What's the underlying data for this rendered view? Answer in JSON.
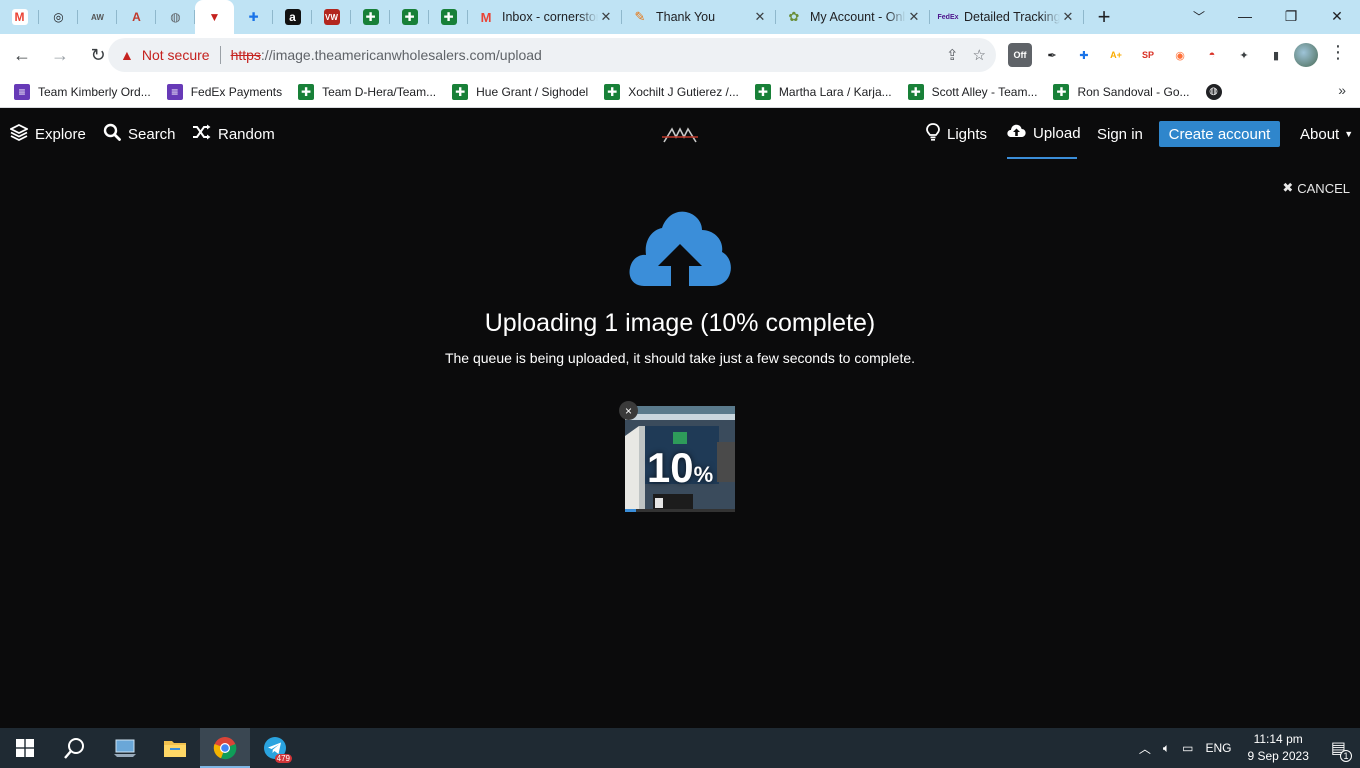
{
  "browser": {
    "pinned_tabs": [
      {
        "name": "gmail",
        "glyph": "M",
        "color": "#ea4335",
        "bg": "#ffffff"
      },
      {
        "name": "chatgpt",
        "glyph": "◎",
        "color": "#202124",
        "bg": "transparent"
      },
      {
        "name": "aw-site",
        "glyph": "AW",
        "color": "#555555",
        "bg": "transparent"
      },
      {
        "name": "aw-site-2",
        "glyph": "A",
        "color": "#c0392b",
        "bg": "transparent"
      },
      {
        "name": "globe",
        "glyph": "◍",
        "color": "#5f6368",
        "bg": "transparent"
      },
      {
        "name": "active-site",
        "glyph": "▼",
        "color": "#c5221f",
        "bg": "transparent"
      },
      {
        "name": "diamond-ext",
        "glyph": "✚",
        "color": "#1a73e8",
        "bg": "transparent"
      },
      {
        "name": "amazon",
        "glyph": "a",
        "color": "#ffffff",
        "bg": "#111111"
      },
      {
        "name": "vw",
        "glyph": "VW",
        "color": "#ffffff",
        "bg": "#b3261e"
      },
      {
        "name": "sheets-1",
        "glyph": "✚",
        "color": "#ffffff",
        "bg": "#188038"
      },
      {
        "name": "sheets-2",
        "glyph": "✚",
        "color": "#ffffff",
        "bg": "#188038"
      },
      {
        "name": "sheets-3",
        "glyph": "✚",
        "color": "#ffffff",
        "bg": "#188038"
      }
    ],
    "wide_tabs": [
      {
        "label": "Inbox - cornerstone",
        "glyph": "M",
        "color": "#ea4335",
        "bg": "transparent"
      },
      {
        "label": "Thank You",
        "glyph": "✎",
        "color": "#e8710a",
        "bg": "transparent"
      },
      {
        "label": "My Account - Online",
        "glyph": "✿",
        "color": "#6a8f3a",
        "bg": "transparent"
      },
      {
        "label": "Detailed Tracking",
        "glyph": "FedEx",
        "color": "#4d148c",
        "bg": "transparent"
      }
    ],
    "url_scheme": "https",
    "url_rest": "://image.theamericanwholesalers.com/upload",
    "security_label": "Not secure",
    "extensions": [
      {
        "name": "off-extension",
        "glyph": "Off",
        "color": "#ffffff",
        "bg": "#5f6368"
      },
      {
        "name": "pen-extension",
        "glyph": "✒",
        "color": "#202124",
        "bg": "transparent"
      },
      {
        "name": "diamond-extension",
        "glyph": "✚",
        "color": "#1a73e8",
        "bg": "transparent"
      },
      {
        "name": "boost-extension",
        "glyph": "A+",
        "color": "#f9ab00",
        "bg": "transparent"
      },
      {
        "name": "alert-extension",
        "glyph": "SP",
        "color": "#d93025",
        "bg": "transparent"
      },
      {
        "name": "firefox-extension",
        "glyph": "◉",
        "color": "#ff7139",
        "bg": "transparent"
      },
      {
        "name": "pokeball-extension",
        "glyph": "◓",
        "color": "#d93025",
        "bg": "transparent"
      },
      {
        "name": "puzzle-extension",
        "glyph": "✦",
        "color": "#3c4043",
        "bg": "transparent"
      },
      {
        "name": "sidepanel-extension",
        "glyph": "▮",
        "color": "#3c4043",
        "bg": "transparent"
      }
    ],
    "bookmarks": [
      {
        "label": "Team Kimberly Ord...",
        "color": "#673ab7",
        "glyph": "≡"
      },
      {
        "label": "FedEx Payments",
        "color": "#673ab7",
        "glyph": "≡"
      },
      {
        "label": "Team D-Hera/Team...",
        "color": "#188038",
        "glyph": "✚"
      },
      {
        "label": "Hue Grant / Sighodel",
        "color": "#188038",
        "glyph": "✚"
      },
      {
        "label": "Xochilt J Gutierez /...",
        "color": "#188038",
        "glyph": "✚"
      },
      {
        "label": "Martha Lara / Karja...",
        "color": "#188038",
        "glyph": "✚"
      },
      {
        "label": "Scott Alley - Team...",
        "color": "#188038",
        "glyph": "✚"
      },
      {
        "label": "Ron Sandoval - Go...",
        "color": "#188038",
        "glyph": "✚"
      }
    ]
  },
  "site": {
    "nav": {
      "explore": "Explore",
      "search": "Search",
      "random": "Random",
      "lights": "Lights",
      "upload": "Upload",
      "sign_in": "Sign in",
      "create_account": "Create account",
      "about": "About"
    },
    "cancel_label": "CANCEL",
    "upload": {
      "title": "Uploading 1 image (10% complete)",
      "subtitle": "The queue is being uploaded, it should take just a few seconds to complete.",
      "percent_value": "10",
      "percent_sign": "%",
      "progress_fraction": 0.1
    },
    "accent_color": "#3b8ed9",
    "cloud_color": "#3b8ed9"
  },
  "taskbar": {
    "language": "ENG",
    "time": "11:14 pm",
    "date": "9 Sep 2023",
    "telegram_badge": "479",
    "notification_count": "1"
  }
}
